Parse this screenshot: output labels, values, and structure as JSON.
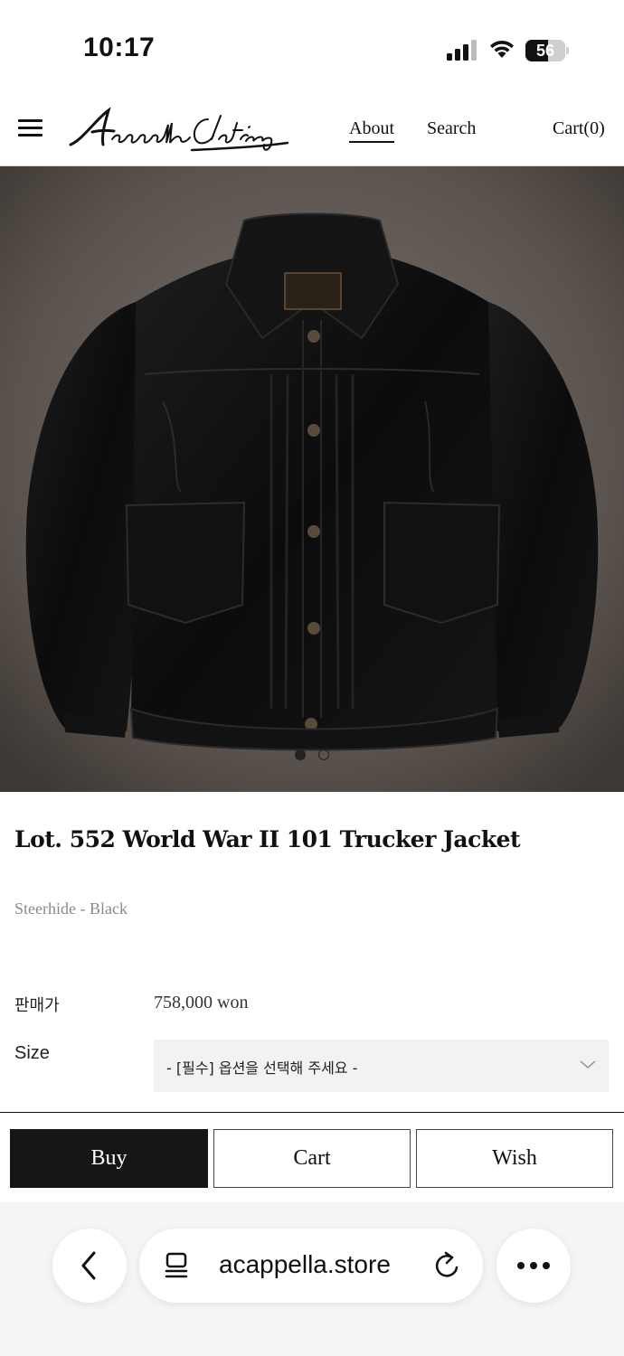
{
  "status_bar": {
    "time": "10:17",
    "battery": "56",
    "battery_level": 0.56,
    "icons": [
      "signal-icon",
      "wifi-icon",
      "battery-icon"
    ]
  },
  "header": {
    "logo_alt": "Acappella Clothing",
    "nav": {
      "about": "About",
      "search": "Search",
      "cart": "Cart(0)"
    }
  },
  "hero": {
    "image_alt": "Black leather trucker jacket",
    "slide_count": 2,
    "active_slide": 1
  },
  "product": {
    "title": "Lot. 552 World War II 101 Trucker Jacket",
    "subtitle": "Steerhide - Black",
    "price_label": "판매가",
    "price_value": "758,000 won",
    "size_label": "Size",
    "size_placeholder": "- [필수] 옵션을 선택해 주세요 -"
  },
  "actions": {
    "buy": "Buy",
    "cart": "Cart",
    "wish": "Wish"
  },
  "browser": {
    "url": "acappella.store",
    "icons": [
      "back-icon",
      "reader-icon",
      "reload-icon",
      "more-icon"
    ]
  },
  "colors": {
    "buy_button_bg": "#161616",
    "text": "#111111",
    "muted_text": "#8a8a8a",
    "select_bg": "#f2f2f2",
    "hero_bg": "#6b625c"
  }
}
